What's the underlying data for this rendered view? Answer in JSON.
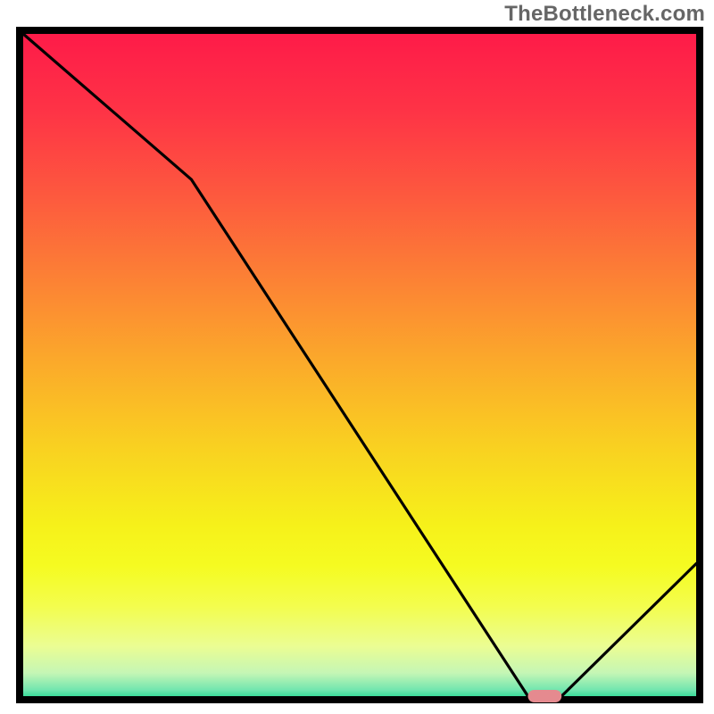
{
  "watermark": "TheBottleneck.com",
  "chart_data": {
    "type": "line",
    "title": "",
    "xlabel": "",
    "ylabel": "",
    "xlim": [
      0,
      100
    ],
    "ylim": [
      0,
      100
    ],
    "grid": false,
    "legend": false,
    "series": [
      {
        "name": "bottleneck-curve",
        "x": [
          0,
          25,
          75,
          80,
          100
        ],
        "y": [
          100,
          78,
          0,
          0,
          20
        ]
      }
    ],
    "marker": {
      "name": "optimal-range",
      "x_start": 75,
      "x_end": 80,
      "y": 0,
      "color": "#e58a8f"
    },
    "background_gradient": {
      "stops": [
        {
          "offset": 0.0,
          "color": "#fe1a49"
        },
        {
          "offset": 0.12,
          "color": "#fe3346"
        },
        {
          "offset": 0.25,
          "color": "#fd5a3e"
        },
        {
          "offset": 0.38,
          "color": "#fc8434"
        },
        {
          "offset": 0.5,
          "color": "#fbab2a"
        },
        {
          "offset": 0.62,
          "color": "#f9d021"
        },
        {
          "offset": 0.74,
          "color": "#f6f11a"
        },
        {
          "offset": 0.8,
          "color": "#f5fb21"
        },
        {
          "offset": 0.86,
          "color": "#f3fd4d"
        },
        {
          "offset": 0.92,
          "color": "#ebfd93"
        },
        {
          "offset": 0.96,
          "color": "#c5f6b5"
        },
        {
          "offset": 0.985,
          "color": "#73e6af"
        },
        {
          "offset": 1.0,
          "color": "#1ad58e"
        }
      ]
    },
    "frame_color": "#000000",
    "line_color": "#000000",
    "line_width": 3.2
  }
}
